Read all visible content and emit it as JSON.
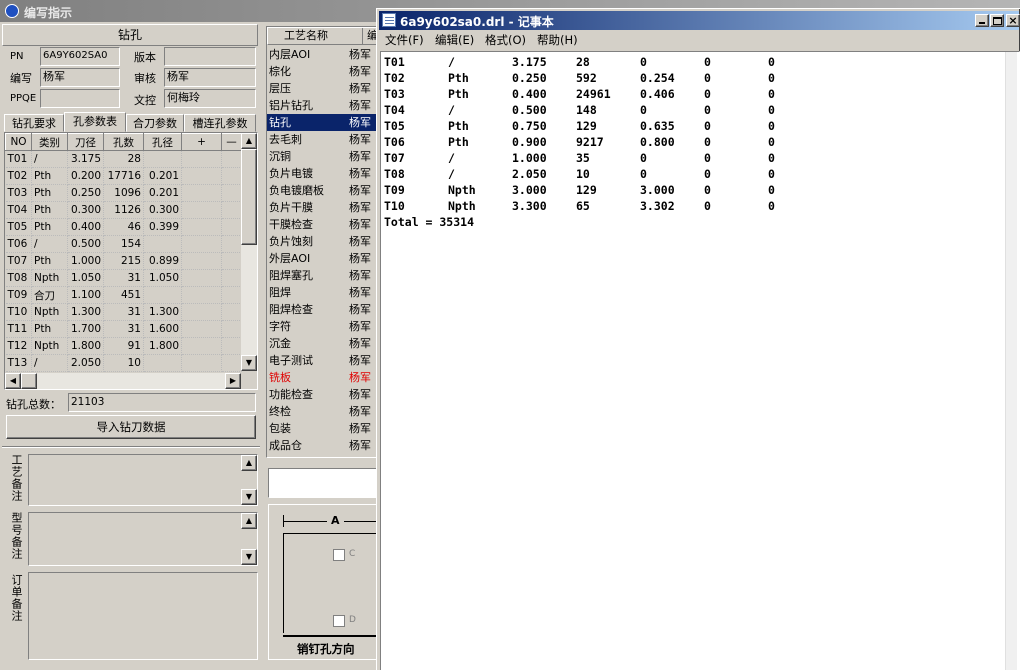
{
  "bg_window": {
    "title": "编写指示",
    "section_title": "钻孔",
    "info": {
      "pn_label": "PN",
      "pn_value": "6A9Y602SA0",
      "version_label": "版本",
      "version_value": "",
      "author_label": "编写",
      "author_value": "杨军",
      "review_label": "审核",
      "review_value": "杨军",
      "ppqe_label": "PPQE",
      "ppqe_value": "",
      "doc_label": "文控",
      "doc_value": "何梅玲"
    },
    "tabs": [
      "钻孔要求",
      "孔参数表",
      "合刀参数",
      "槽连孔参数"
    ],
    "active_tab": "孔参数表",
    "table": {
      "headers": [
        "NO",
        "类别",
        "刀径",
        "孔数",
        "孔径",
        "+",
        "—"
      ],
      "rows": [
        {
          "no": "T01",
          "type": "/",
          "dia": "3.175",
          "count": "28",
          "hole": ""
        },
        {
          "no": "T02",
          "type": "Pth",
          "dia": "0.200",
          "count": "17716",
          "hole": "0.201"
        },
        {
          "no": "T03",
          "type": "Pth",
          "dia": "0.250",
          "count": "1096",
          "hole": "0.201"
        },
        {
          "no": "T04",
          "type": "Pth",
          "dia": "0.300",
          "count": "1126",
          "hole": "0.300"
        },
        {
          "no": "T05",
          "type": "Pth",
          "dia": "0.400",
          "count": "46",
          "hole": "0.399"
        },
        {
          "no": "T06",
          "type": "/",
          "dia": "0.500",
          "count": "154",
          "hole": ""
        },
        {
          "no": "T07",
          "type": "Pth",
          "dia": "1.000",
          "count": "215",
          "hole": "0.899"
        },
        {
          "no": "T08",
          "type": "Npth",
          "dia": "1.050",
          "count": "31",
          "hole": "1.050"
        },
        {
          "no": "T09",
          "type": "合刀",
          "dia": "1.100",
          "count": "451",
          "hole": ""
        },
        {
          "no": "T10",
          "type": "Npth",
          "dia": "1.300",
          "count": "31",
          "hole": "1.300"
        },
        {
          "no": "T11",
          "type": "Pth",
          "dia": "1.700",
          "count": "31",
          "hole": "1.600"
        },
        {
          "no": "T12",
          "type": "Npth",
          "dia": "1.800",
          "count": "91",
          "hole": "1.800"
        },
        {
          "no": "T13",
          "type": "/",
          "dia": "2.050",
          "count": "10",
          "hole": ""
        }
      ]
    },
    "total_label": "钻孔总数：",
    "total_value": "21103",
    "import_button": "导入钻刀数据",
    "note_labels": [
      "工艺备注",
      "型号备注",
      "订单备注"
    ],
    "process_list": {
      "header_name": "工艺名称",
      "header_editor": "编",
      "items": [
        {
          "name": "内层AOI",
          "editor": "杨军"
        },
        {
          "name": "棕化",
          "editor": "杨军"
        },
        {
          "name": "层压",
          "editor": "杨军"
        },
        {
          "name": "铝片钻孔",
          "editor": "杨军"
        },
        {
          "name": "钻孔",
          "editor": "杨军"
        },
        {
          "name": "去毛刺",
          "editor": "杨军"
        },
        {
          "name": "沉铜",
          "editor": "杨军"
        },
        {
          "name": "负片电镀",
          "editor": "杨军"
        },
        {
          "name": "负电镀磨板",
          "editor": "杨军"
        },
        {
          "name": "负片干膜",
          "editor": "杨军"
        },
        {
          "name": "干膜检查",
          "editor": "杨军"
        },
        {
          "name": "负片蚀刻",
          "editor": "杨军"
        },
        {
          "name": "外层AOI",
          "editor": "杨军"
        },
        {
          "name": "阻焊塞孔",
          "editor": "杨军"
        },
        {
          "name": "阻焊",
          "editor": "杨军"
        },
        {
          "name": "阻焊检查",
          "editor": "杨军"
        },
        {
          "name": "字符",
          "editor": "杨军"
        },
        {
          "name": "沉金",
          "editor": "杨军"
        },
        {
          "name": "电子测试",
          "editor": "杨军"
        },
        {
          "name": "铣板",
          "editor": "杨军"
        },
        {
          "name": "功能检查",
          "editor": "杨军"
        },
        {
          "name": "终检",
          "editor": "杨军"
        },
        {
          "name": "包装",
          "editor": "杨军"
        },
        {
          "name": "成品仓",
          "editor": "杨军"
        }
      ],
      "selected_index": 4,
      "highlight_index": 19
    },
    "diagram": {
      "label_a": "A",
      "label_c": "C",
      "label_d": "D",
      "caption": "销钉孔方向"
    }
  },
  "notepad": {
    "title": "6a9y602sa0.drl - 记事本",
    "menu": [
      "文件(F)",
      "编辑(E)",
      "格式(O)",
      "帮助(H)"
    ],
    "lines": [
      [
        "T01",
        "/",
        "3.175",
        "28",
        "0",
        "0",
        "0"
      ],
      [
        "T02",
        "Pth",
        "0.250",
        "592",
        "0.254",
        "0",
        "0"
      ],
      [
        "T03",
        "Pth",
        "0.400",
        "24961",
        "0.406",
        "0",
        "0"
      ],
      [
        "T04",
        "/",
        "0.500",
        "148",
        "0",
        "0",
        "0"
      ],
      [
        "T05",
        "Pth",
        "0.750",
        "129",
        "0.635",
        "0",
        "0"
      ],
      [
        "T06",
        "Pth",
        "0.900",
        "9217",
        "0.800",
        "0",
        "0"
      ],
      [
        "T07",
        "/",
        "1.000",
        "35",
        "0",
        "0",
        "0"
      ],
      [
        "T08",
        "/",
        "2.050",
        "10",
        "0",
        "0",
        "0"
      ],
      [
        "T09",
        "Npth",
        "3.000",
        "129",
        "3.000",
        "0",
        "0"
      ],
      [
        "T10",
        "Npth",
        "3.300",
        "65",
        "3.302",
        "0",
        "0"
      ]
    ],
    "total_line": "Total = 35314"
  },
  "colors": {
    "selection": "#0a246a",
    "highlight_text": "#e00000",
    "face": "#d4d0c8"
  }
}
